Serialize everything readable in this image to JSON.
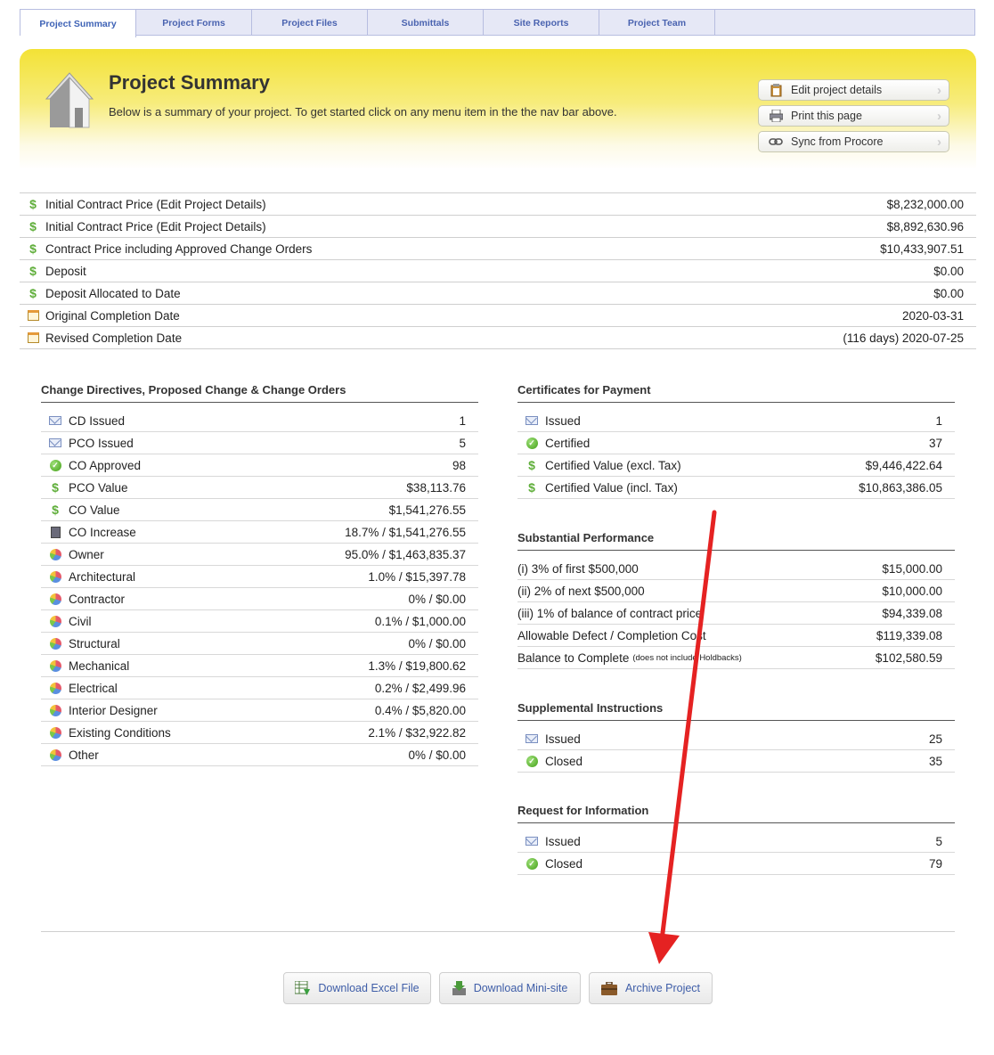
{
  "tabs": [
    {
      "label": "Project Summary",
      "active": true
    },
    {
      "label": "Project Forms"
    },
    {
      "label": "Project Files"
    },
    {
      "label": "Submittals"
    },
    {
      "label": "Site Reports"
    },
    {
      "label": "Project Team"
    }
  ],
  "banner": {
    "title": "Project Summary",
    "subtitle": "Below is a summary of your project. To get started click on any menu item in the the nav bar above.",
    "actions": [
      {
        "label": "Edit project details",
        "icon": "clipboard-icon"
      },
      {
        "label": "Print this page",
        "icon": "printer-icon"
      },
      {
        "label": "Sync from Procore",
        "icon": "link-icon"
      }
    ]
  },
  "summary": [
    {
      "icon": "dollar-icon",
      "label": "Initial Contract Price (Edit Project Details)",
      "value": "$8,232,000.00"
    },
    {
      "icon": "dollar-icon",
      "label": "Initial Contract Price (Edit Project Details)",
      "value": "$8,892,630.96"
    },
    {
      "icon": "dollar-icon",
      "label": "Contract Price including Approved Change Orders",
      "value": "$10,433,907.51"
    },
    {
      "icon": "dollar-icon",
      "label": "Deposit",
      "value": "$0.00"
    },
    {
      "icon": "dollar-icon",
      "label": "Deposit Allocated to Date",
      "value": "$0.00"
    },
    {
      "icon": "calendar-icon",
      "label": "Original Completion Date",
      "value": "2020-03-31"
    },
    {
      "icon": "calendar-icon",
      "label": "Revised Completion Date",
      "value": "(116 days) 2020-07-25"
    }
  ],
  "change_orders": {
    "title": "Change Directives, Proposed Change & Change Orders",
    "rows": [
      {
        "icon": "envelope-icon",
        "label": "CD Issued",
        "value": "1"
      },
      {
        "icon": "envelope-icon",
        "label": "PCO Issued",
        "value": "5"
      },
      {
        "icon": "check-icon",
        "label": "CO Approved",
        "value": "98"
      },
      {
        "icon": "dollar-icon",
        "label": "PCO Value",
        "value": "$38,113.76"
      },
      {
        "icon": "dollar-icon",
        "label": "CO Value",
        "value": "$1,541,276.55"
      },
      {
        "icon": "calculator-icon",
        "label": "CO Increase",
        "value": "18.7% / $1,541,276.55"
      },
      {
        "icon": "pie-chart-icon",
        "label": "Owner",
        "value": "95.0% / $1,463,835.37"
      },
      {
        "icon": "pie-chart-icon",
        "label": "Architectural",
        "value": "1.0% / $15,397.78"
      },
      {
        "icon": "pie-chart-icon",
        "label": "Contractor",
        "value": "0% / $0.00"
      },
      {
        "icon": "pie-chart-icon",
        "label": "Civil",
        "value": "0.1% / $1,000.00"
      },
      {
        "icon": "pie-chart-icon",
        "label": "Structural",
        "value": "0% / $0.00"
      },
      {
        "icon": "pie-chart-icon",
        "label": "Mechanical",
        "value": "1.3% / $19,800.62"
      },
      {
        "icon": "pie-chart-icon",
        "label": "Electrical",
        "value": "0.2% / $2,499.96"
      },
      {
        "icon": "pie-chart-icon",
        "label": "Interior Designer",
        "value": "0.4% / $5,820.00"
      },
      {
        "icon": "pie-chart-icon",
        "label": "Existing Conditions",
        "value": "2.1% / $32,922.82"
      },
      {
        "icon": "pie-chart-icon",
        "label": "Other",
        "value": "0% / $0.00"
      }
    ]
  },
  "certificates": {
    "title": "Certificates for Payment",
    "rows": [
      {
        "icon": "envelope-icon",
        "label": "Issued",
        "value": "1"
      },
      {
        "icon": "check-icon",
        "label": "Certified",
        "value": "37"
      },
      {
        "icon": "dollar-icon",
        "label": "Certified Value (excl. Tax)",
        "value": "$9,446,422.64"
      },
      {
        "icon": "dollar-icon",
        "label": "Certified Value (incl. Tax)",
        "value": "$10,863,386.05"
      }
    ]
  },
  "substantial": {
    "title": "Substantial Performance",
    "rows": [
      {
        "label": "(i) 3% of first $500,000",
        "value": "$15,000.00"
      },
      {
        "label": "(ii) 2% of next $500,000",
        "value": "$10,000.00"
      },
      {
        "label": "(iii) 1% of balance of contract price",
        "value": "$94,339.08"
      },
      {
        "label": "Allowable Defect / Completion Cost",
        "value": "$119,339.08"
      },
      {
        "label": "Balance to Complete",
        "note": "(does not include Holdbacks)",
        "value": "$102,580.59"
      }
    ]
  },
  "supplemental": {
    "title": "Supplemental Instructions",
    "rows": [
      {
        "icon": "envelope-icon",
        "label": "Issued",
        "value": "25"
      },
      {
        "icon": "check-icon",
        "label": "Closed",
        "value": "35"
      }
    ]
  },
  "rfi": {
    "title": "Request for Information",
    "rows": [
      {
        "icon": "envelope-icon",
        "label": "Issued",
        "value": "5"
      },
      {
        "icon": "check-icon",
        "label": "Closed",
        "value": "79"
      }
    ]
  },
  "bottom_buttons": [
    {
      "label": "Download Excel File",
      "icon": "spreadsheet-icon"
    },
    {
      "label": "Download Mini-site",
      "icon": "download-icon"
    },
    {
      "label": "Archive Project",
      "icon": "briefcase-icon"
    }
  ],
  "colors": {
    "accent": "#3f63b6",
    "banner": "#f3e236",
    "arrow": "#e52222",
    "dollar": "#5fae3a"
  }
}
